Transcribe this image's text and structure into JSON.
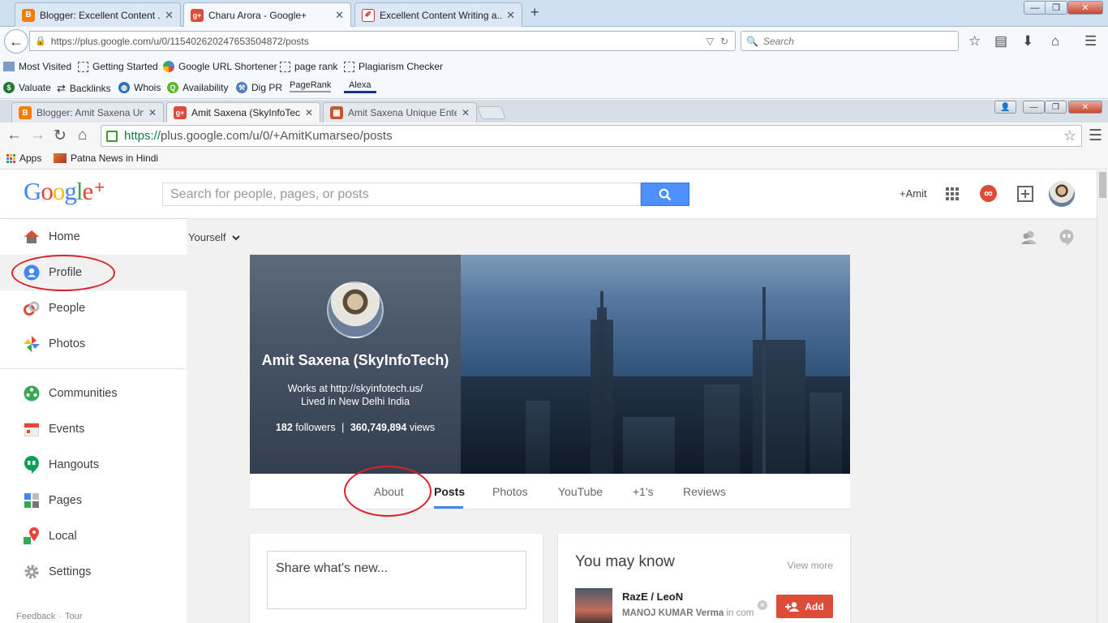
{
  "outer_browser": {
    "tabs": [
      {
        "title": "Blogger: Excellent Content ...",
        "favicon": "blogger-icon"
      },
      {
        "title": "Charu Arora - Google+",
        "favicon": "google-plus-icon"
      },
      {
        "title": "Excellent Content Writing a...",
        "favicon": "pen-icon"
      }
    ],
    "new_tab": "+",
    "url": "https://plus.google.com/u/0/115402620247653504872/posts",
    "search_placeholder": "Search",
    "bookmarks_row1": [
      "Most Visited",
      "Getting Started",
      "Google URL Shortener",
      "page rank",
      "Plagiarism Checker"
    ],
    "bookmarks_row2": [
      "Valuate",
      "Backlinks",
      "Whois",
      "Availability",
      "Dig PR",
      "PageRank",
      "Alexa"
    ]
  },
  "inner_browser": {
    "tabs": [
      {
        "title": "Blogger: Amit Saxena Unic",
        "favicon": "blogger-icon"
      },
      {
        "title": "Amit Saxena (SkyInfoTech",
        "favicon": "google-plus-icon"
      },
      {
        "title": "Amit Saxena Unique Enter",
        "favicon": "gallery-icon"
      }
    ],
    "url_scheme": "https://",
    "url_rest": "plus.google.com/u/0/+AmitKumarseo/posts",
    "bookmarks": [
      "Apps",
      "Patna News in Hindi"
    ]
  },
  "gplus": {
    "logo": {
      "google": [
        "G",
        "o",
        "o",
        "g",
        "l",
        "e"
      ],
      "plus": "+"
    },
    "search_placeholder": "Search for people, pages, or posts",
    "user_label": "+Amit",
    "notification_glyph": "∞",
    "nav": [
      {
        "label": "Home"
      },
      {
        "label": "Profile"
      },
      {
        "label": "People"
      },
      {
        "label": "Photos"
      },
      {
        "label": "Communities"
      },
      {
        "label": "Events"
      },
      {
        "label": "Hangouts"
      },
      {
        "label": "Pages"
      },
      {
        "label": "Local"
      },
      {
        "label": "Settings"
      }
    ],
    "footer": {
      "feedback": "Feedback",
      "sep": "·",
      "tour": "Tour"
    },
    "subbar_label": "Yourself",
    "profile": {
      "name": "Amit Saxena (SkyInfoTech)",
      "work": "Works at http://skyinfotech.us/",
      "location": "Lived in New Delhi India",
      "followers": "182",
      "followers_label": "followers",
      "stats_sep": "|",
      "views": "360,749,894",
      "views_label": "views"
    },
    "profile_tabs": [
      "About",
      "Posts",
      "Photos",
      "YouTube",
      "+1's",
      "Reviews"
    ],
    "active_tab": "Posts",
    "share_placeholder": "Share what's new...",
    "you_may_know": {
      "title": "You may know",
      "view_more": "View more",
      "person_name": "RazE / LeoN",
      "person_sub_bold": "MANOJ KUMAR Verma",
      "person_sub": " in common",
      "add_label": "Add"
    }
  },
  "colors": {
    "google_blue": "#4285f4",
    "google_red": "#ea4335",
    "google_yellow": "#fbbc05",
    "google_green": "#34a853",
    "gplus_red": "#dd4b39",
    "search_blue": "#4d90fe",
    "annotation_red": "#d9222a"
  }
}
